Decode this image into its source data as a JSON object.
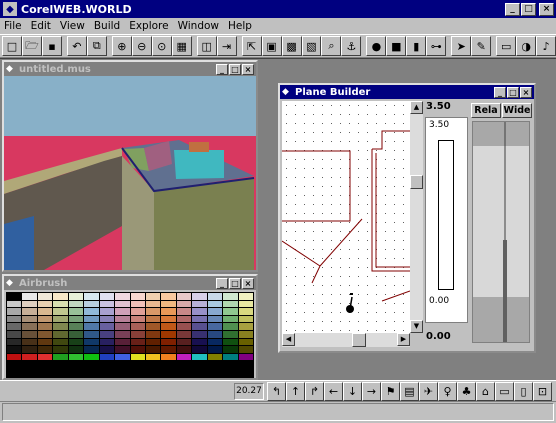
{
  "window": {
    "title": "CorelWEB.WORLD",
    "minimize": "_",
    "maximize": "□",
    "close": "×"
  },
  "menu": [
    "File",
    "Edit",
    "View",
    "Build",
    "Explore",
    "Window",
    "Help"
  ],
  "toolbar": {
    "icons": [
      "new-file-icon",
      "open-folder-icon",
      "save-disk-icon",
      "undo-icon",
      "copy-icon",
      "zoom-in-icon",
      "zoom-out-icon",
      "zoom-fit-icon",
      "grid-icon",
      "render-icon",
      "export-icon",
      "walk-icon",
      "light-icon",
      "texture-icon",
      "image-icon",
      "find-icon",
      "anchor-icon",
      "sphere-icon",
      "cube-icon",
      "cylinder-icon",
      "link-icon",
      "cursor-icon",
      "wand-icon",
      "frame-icon",
      "globe-icon",
      "sound-icon"
    ],
    "glyphs": [
      "□",
      "🗁",
      "▪",
      "↶",
      "⧉",
      "⊕",
      "⊖",
      "⊙",
      "▦",
      "◫",
      "⇥",
      "⇱",
      "▣",
      "▩",
      "▧",
      "⌕",
      "⚓",
      "●",
      "■",
      "▮",
      "⊶",
      "➤",
      "✎",
      "▭",
      "◑",
      "♪"
    ]
  },
  "view3d": {
    "title": "untitled.mus"
  },
  "airbrush": {
    "title": "Airbrush",
    "colors": [
      "#000000",
      "#e8e8e8",
      "#f0e8d8",
      "#f8e8c8",
      "#e8f0d8",
      "#d8e8f0",
      "#e0e0f0",
      "#f0d8e0",
      "#f8d8d0",
      "#f0d0b0",
      "#f8c8a0",
      "#e8c8c8",
      "#d8d0e8",
      "#c8d8e8",
      "#d0e8d0",
      "#f0f0c0",
      "#c8c8c8",
      "#e0d0c0",
      "#e8d0b0",
      "#d8e0b0",
      "#c0d8c0",
      "#b8d0e0",
      "#c8c0e0",
      "#e0c0d0",
      "#f0c0b8",
      "#e8b890",
      "#f0b880",
      "#d8a8a8",
      "#b8b0d8",
      "#a8c8e0",
      "#b0d8b0",
      "#e8e8a0",
      "#a8a8a8",
      "#c8b098",
      "#d8b890",
      "#c0c890",
      "#98c098",
      "#90b8d8",
      "#a8a0d0",
      "#d0a0b8",
      "#e0a098",
      "#d89868",
      "#e89858",
      "#c88888",
      "#9890c8",
      "#88a8d0",
      "#90c890",
      "#d8d880",
      "#888888",
      "#a89078",
      "#c09870",
      "#a0a870",
      "#78a078",
      "#7098c0",
      "#8880b8",
      "#b88098",
      "#c88078",
      "#c07848",
      "#d87838",
      "#b06868",
      "#7870b0",
      "#6888b8",
      "#70b070",
      "#c0c060",
      "#686868",
      "#887058",
      "#a07850",
      "#808850",
      "#588058",
      "#5078a8",
      "#6860a0",
      "#986078",
      "#a86058",
      "#a05828",
      "#c05818",
      "#985050",
      "#585090",
      "#4868a0",
      "#509050",
      "#a8a040",
      "#484848",
      "#685038",
      "#805830",
      "#606830",
      "#386038",
      "#305888",
      "#484080",
      "#784058",
      "#884038",
      "#803810",
      "#a03800",
      "#783838",
      "#383070",
      "#284880",
      "#307030",
      "#888020",
      "#282828",
      "#483018",
      "#603810",
      "#404810",
      "#184018",
      "#103868",
      "#282060",
      "#582038",
      "#682018",
      "#602000",
      "#802000",
      "#582020",
      "#181050",
      "#082860",
      "#105010",
      "#686000",
      "#101010",
      "#302010",
      "#402808",
      "#303808",
      "#103010",
      "#082850",
      "#181048",
      "#401028",
      "#501008",
      "#481800",
      "#601800",
      "#401010",
      "#100838",
      "#001848",
      "#083808",
      "#504800",
      "#c01010",
      "#d02020",
      "#e03030",
      "#20a020",
      "#30c030",
      "#10c010",
      "#2040c0",
      "#4060e0",
      "#e0e020",
      "#f0c020",
      "#f08020",
      "#c020c0",
      "#20c0c0",
      "#808000",
      "#008080",
      "#800080"
    ]
  },
  "plane_builder": {
    "title": "Plane Builder",
    "elevation_top": "3.50",
    "elevation_top_inner": "3.50",
    "elevation_bottom_inner": "0.00",
    "elevation_bottom": "0.00",
    "btn_relative": "Rela",
    "btn_wide": "Wide"
  },
  "bottom_toolbar": {
    "coord": "20.27",
    "icons": [
      "turn-left-icon",
      "forward-icon",
      "turn-right-icon",
      "move-left-icon",
      "move-down-icon",
      "move-right-icon",
      "walk-icon",
      "camera-icon",
      "fly-icon",
      "person-icon",
      "tree-icon",
      "house-icon",
      "card-icon",
      "doc-icon",
      "sign-icon"
    ],
    "glyphs": [
      "↰",
      "↑",
      "↱",
      "←",
      "↓",
      "→",
      "⚑",
      "▤",
      "✈",
      "♀",
      "♣",
      "⌂",
      "▭",
      "▯",
      "⊡"
    ]
  }
}
